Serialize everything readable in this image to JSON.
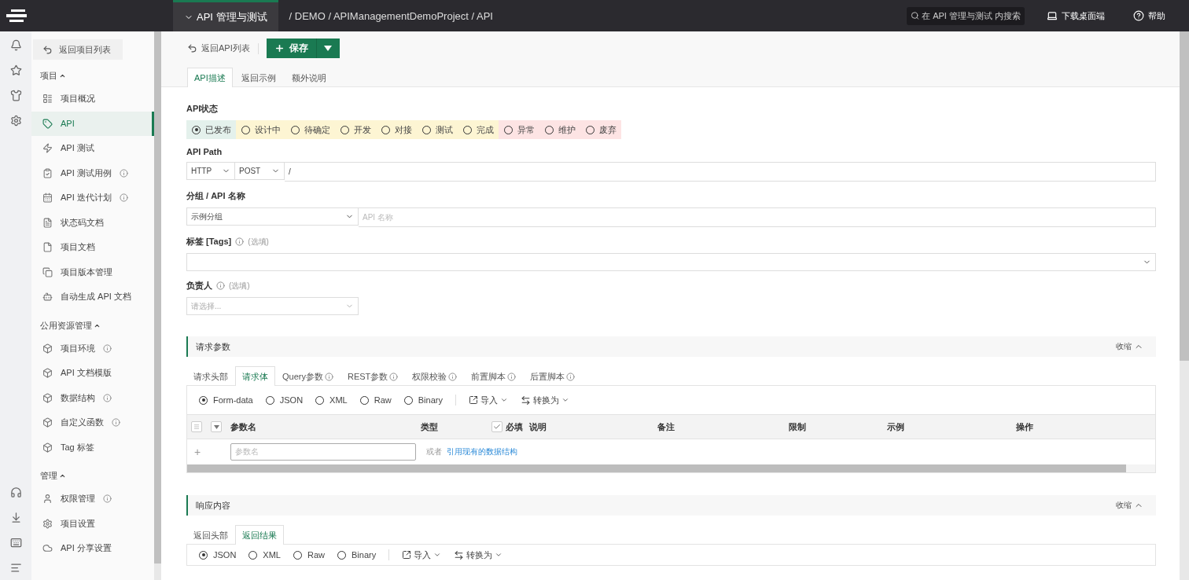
{
  "topbar": {
    "module": "API 管理与测试",
    "breadcrumb": "/ DEMO / APIManagementDemoProject / API",
    "search": {
      "placeholder": "在 API 管理与测试 内搜索"
    },
    "download": "下载桌面端",
    "help": "帮助"
  },
  "sidebar": {
    "back": "返回项目列表",
    "sections": [
      {
        "title": "项目",
        "expanded": true,
        "items": [
          {
            "label": "项目概况",
            "info": false,
            "selected": false
          },
          {
            "label": "API",
            "info": false,
            "selected": true
          },
          {
            "label": "API 测试",
            "info": false,
            "selected": false
          },
          {
            "label": "API 测试用例",
            "info": true,
            "selected": false
          },
          {
            "label": "API 迭代计划",
            "info": true,
            "selected": false
          },
          {
            "label": "状态码文档",
            "info": false,
            "selected": false
          },
          {
            "label": "项目文档",
            "info": false,
            "selected": false
          },
          {
            "label": "项目版本管理",
            "info": false,
            "selected": false
          },
          {
            "label": "自动生成 API 文档",
            "info": false,
            "selected": false
          }
        ]
      },
      {
        "title": "公用资源管理",
        "expanded": true,
        "items": [
          {
            "label": "项目环境",
            "info": true,
            "selected": false
          },
          {
            "label": "API 文档模版",
            "info": false,
            "selected": false
          },
          {
            "label": "数据结构",
            "info": true,
            "selected": false
          },
          {
            "label": "自定义函数",
            "info": true,
            "selected": false
          },
          {
            "label": "Tag 标签",
            "info": false,
            "selected": false
          }
        ]
      },
      {
        "title": "管理",
        "expanded": true,
        "items": [
          {
            "label": "权限管理",
            "info": true,
            "selected": false
          },
          {
            "label": "项目设置",
            "info": false,
            "selected": false
          },
          {
            "label": "API 分享设置",
            "info": false,
            "selected": false
          }
        ]
      }
    ]
  },
  "toolbar": {
    "back": "返回API列表",
    "save": "保存"
  },
  "tabs": [
    {
      "label": "API描述",
      "selected": true
    },
    {
      "label": "返回示例",
      "selected": false
    },
    {
      "label": "额外说明",
      "selected": false
    }
  ],
  "status": {
    "label": "API状态",
    "options": [
      {
        "label": "已发布",
        "selected": true,
        "color": "#e4f1ec"
      },
      {
        "label": "设计中",
        "selected": false,
        "color": "#fdf5d3"
      },
      {
        "label": "待确定",
        "selected": false,
        "color": "#fdf5d3"
      },
      {
        "label": "开发",
        "selected": false,
        "color": "#fdf5d3"
      },
      {
        "label": "对接",
        "selected": false,
        "color": "#fdf5d3"
      },
      {
        "label": "测试",
        "selected": false,
        "color": "#fdf5d3"
      },
      {
        "label": "完成",
        "selected": false,
        "color": "#fdf5d3"
      },
      {
        "label": "异常",
        "selected": false,
        "color": "#fde4e4"
      },
      {
        "label": "维护",
        "selected": false,
        "color": "#fde4e4"
      },
      {
        "label": "废弃",
        "selected": false,
        "color": "#fde4e4"
      }
    ]
  },
  "path": {
    "label": "API Path",
    "protocol": "HTTP",
    "method": "POST",
    "value": "/"
  },
  "name": {
    "label": "分组 / API 名称",
    "group": "示例分组",
    "placeholder": "API 名称"
  },
  "tags": {
    "label": "标签 [Tags]",
    "optional": "(选填)"
  },
  "owner": {
    "label": "负责人",
    "optional": "(选填)",
    "placeholder": "请选择..."
  },
  "request": {
    "title": "请求参数",
    "collapse": "收缩",
    "tabs": [
      {
        "label": "请求头部",
        "info": false,
        "selected": false
      },
      {
        "label": "请求体",
        "info": false,
        "selected": true
      },
      {
        "label": "Query参数",
        "info": true,
        "selected": false
      },
      {
        "label": "REST参数",
        "info": true,
        "selected": false
      },
      {
        "label": "权限校验",
        "info": true,
        "selected": false
      },
      {
        "label": "前置脚本",
        "info": true,
        "selected": false
      },
      {
        "label": "后置脚本",
        "info": true,
        "selected": false
      }
    ],
    "formats": [
      {
        "label": "Form-data",
        "selected": true
      },
      {
        "label": "JSON",
        "selected": false
      },
      {
        "label": "XML",
        "selected": false
      },
      {
        "label": "Raw",
        "selected": false
      },
      {
        "label": "Binary",
        "selected": false
      }
    ],
    "import": "导入",
    "convert": "转换为",
    "columns": [
      {
        "label": "参数名",
        "kind": "text"
      },
      {
        "label": "类型",
        "kind": "text"
      },
      {
        "label": "必填",
        "kind": "check",
        "checked": true
      },
      {
        "label": "说明",
        "kind": "text"
      },
      {
        "label": "备注",
        "kind": "text"
      },
      {
        "label": "限制",
        "kind": "text"
      },
      {
        "label": "示例",
        "kind": "text"
      },
      {
        "label": "操作",
        "kind": "text"
      }
    ],
    "new_row": {
      "add": "+",
      "placeholder": "参数名",
      "or": "或者",
      "link": "引用现有的数据结构"
    }
  },
  "response": {
    "title": "响应内容",
    "collapse": "收缩",
    "tabs": [
      {
        "label": "返回头部",
        "info": false,
        "selected": false
      },
      {
        "label": "返回结果",
        "info": false,
        "selected": true
      }
    ],
    "formats": [
      {
        "label": "JSON",
        "selected": true
      },
      {
        "label": "XML",
        "selected": false
      },
      {
        "label": "Raw",
        "selected": false
      },
      {
        "label": "Binary",
        "selected": false
      }
    ],
    "import": "导入",
    "convert": "转换为"
  }
}
